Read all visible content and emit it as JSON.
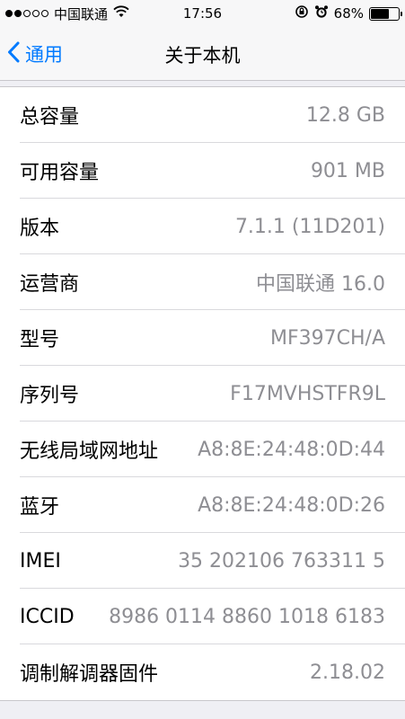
{
  "status_bar": {
    "carrier": "中国联通",
    "time": "17:56",
    "battery_percent": "68%",
    "battery_level": 0.68
  },
  "nav": {
    "back_label": "通用",
    "title": "关于本机"
  },
  "rows": [
    {
      "label": "总容量",
      "value": "12.8 GB"
    },
    {
      "label": "可用容量",
      "value": "901 MB"
    },
    {
      "label": "版本",
      "value": "7.1.1 (11D201)"
    },
    {
      "label": "运营商",
      "value": "中国联通 16.0"
    },
    {
      "label": "型号",
      "value": "MF397CH/A"
    },
    {
      "label": "序列号",
      "value": "F17MVHSTFR9L"
    },
    {
      "label": "无线局域网地址",
      "value": "A8:8E:24:48:0D:44"
    },
    {
      "label": "蓝牙",
      "value": "A8:8E:24:48:0D:26"
    },
    {
      "label": "IMEI",
      "value": "35 202106 763311 5"
    },
    {
      "label": "ICCID",
      "value": "8986 0114 8860 1018 6183"
    },
    {
      "label": "调制解调器固件",
      "value": "2.18.02"
    }
  ],
  "colors": {
    "accent": "#007aff",
    "value_text": "#8e8e93",
    "background": "#efeff4"
  }
}
